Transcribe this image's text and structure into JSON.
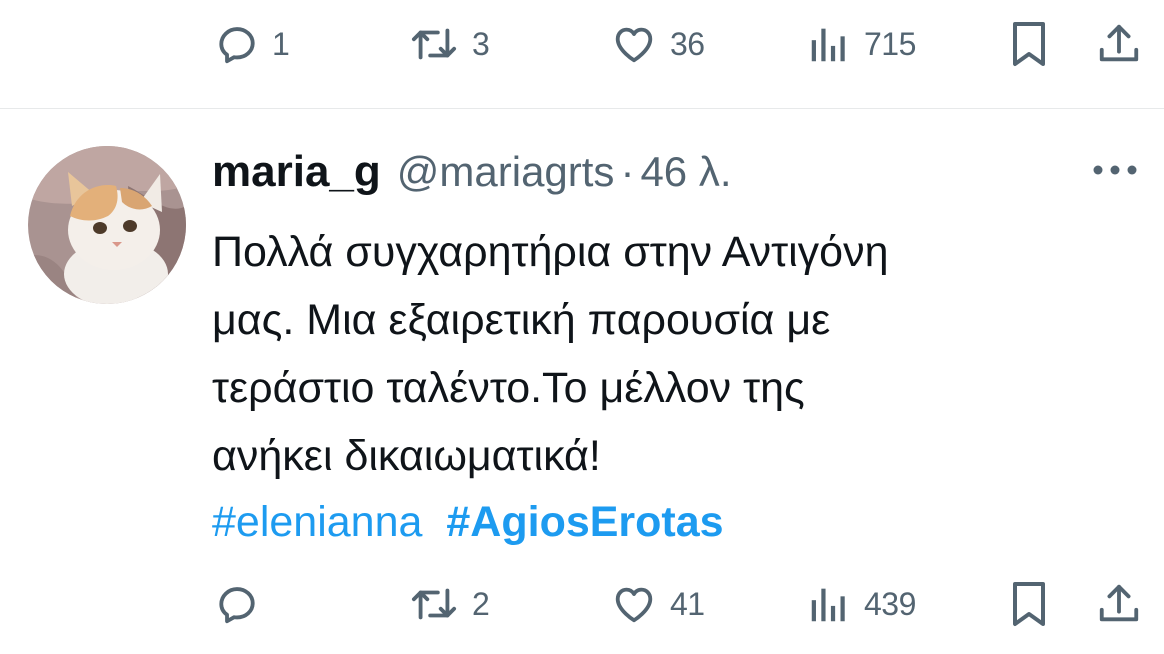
{
  "previous_tweet": {
    "actions": {
      "reply_count": "1",
      "retweet_count": "3",
      "like_count": "36",
      "view_count": "715"
    }
  },
  "tweet": {
    "display_name": "maria_g",
    "handle": "@mariagrts",
    "separator": "·",
    "time": "46 λ.",
    "text_lines": [
      "Πολλά συγχαρητήρια στην Αντιγόνη",
      "μας. Μια εξαιρετική παρουσία με",
      "τεράστιο ταλέντο.Το μέλλον της",
      "ανήκει δικαιωματικά!"
    ],
    "hashtags": [
      "#elenianna",
      "#AgiosErotas"
    ],
    "actions": {
      "reply_count": "",
      "retweet_count": "2",
      "like_count": "41",
      "view_count": "439"
    }
  },
  "icons": {
    "reply": "reply-icon",
    "retweet": "retweet-icon",
    "like": "heart-icon",
    "views": "views-icon",
    "bookmark": "bookmark-icon",
    "share": "share-icon",
    "more": "more-icon"
  },
  "colors": {
    "icon_gray": "#536471",
    "text": "#0f1419",
    "link_blue": "#1d9bf0",
    "divider": "#e7e9ea"
  }
}
